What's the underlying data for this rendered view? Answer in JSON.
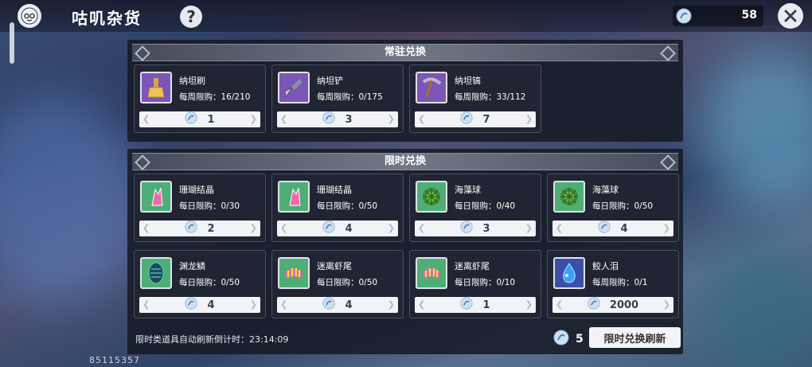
{
  "header": {
    "title": "咕叽杂货",
    "help_label": "?",
    "currency_value": "58"
  },
  "permanent": {
    "title": "常驻兑换",
    "items": [
      {
        "name": "纳坦刷",
        "limit": "每周限购：16/210",
        "price": "1",
        "icon": "brush-icon"
      },
      {
        "name": "纳坦铲",
        "limit": "每周限购：0/175",
        "price": "3",
        "icon": "trowel-icon"
      },
      {
        "name": "纳坦镐",
        "limit": "每周限购：33/112",
        "price": "7",
        "icon": "pickaxe-icon"
      }
    ]
  },
  "limited": {
    "title": "限时兑换",
    "items": [
      {
        "name": "珊瑚结晶",
        "limit": "每日限购：0/30",
        "price": "2",
        "icon": "coral-crystal-icon"
      },
      {
        "name": "珊瑚结晶",
        "limit": "每日限购：0/50",
        "price": "4",
        "icon": "coral-crystal-icon"
      },
      {
        "name": "海藻球",
        "limit": "每日限购：0/40",
        "price": "3",
        "icon": "seaweed-ball-icon"
      },
      {
        "name": "海藻球",
        "limit": "每日限购：0/50",
        "price": "4",
        "icon": "seaweed-ball-icon"
      },
      {
        "name": "渊龙鳞",
        "limit": "每日限购：0/50",
        "price": "4",
        "icon": "dragon-scale-icon"
      },
      {
        "name": "迷离虾尾",
        "limit": "每日限购：0/50",
        "price": "4",
        "icon": "shrimp-tail-icon"
      },
      {
        "name": "迷离虾尾",
        "limit": "每日限购：0/10",
        "price": "1",
        "icon": "shrimp-tail-icon"
      },
      {
        "name": "鲛人泪",
        "limit": "每周限购：0/1",
        "price": "2000",
        "icon": "mermaid-tear-icon"
      }
    ]
  },
  "footer": {
    "countdown": "限时类道具自动刷新倒计时：23:14:09",
    "refresh_cost": "5",
    "refresh_label": "限时兑换刷新",
    "uid": "85115357"
  },
  "colors": {
    "panel": "#161a26",
    "card": "#222634",
    "price_bg": "#f2f3f6"
  }
}
